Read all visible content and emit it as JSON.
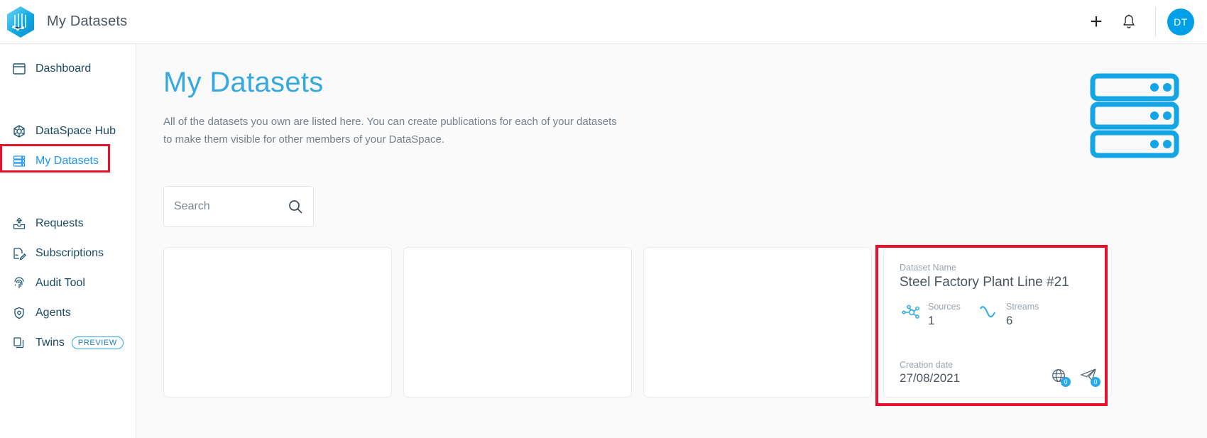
{
  "app": {
    "title": "My Datasets",
    "logo_icon": "hexagon-network-logo"
  },
  "topbar": {
    "add_icon": "plus-icon",
    "notifications_icon": "bell-icon",
    "avatar_initials": "DT"
  },
  "sidebar": {
    "items": [
      {
        "label": "Dashboard",
        "icon": "dashboard-icon",
        "active": false
      },
      {
        "label": "DataSpace Hub",
        "icon": "hub-icon",
        "active": false
      },
      {
        "label": "My Datasets",
        "icon": "database-icon",
        "active": true
      },
      {
        "label": "Requests",
        "icon": "inbox-upload-icon",
        "active": false
      },
      {
        "label": "Subscriptions",
        "icon": "signed-document-icon",
        "active": false
      },
      {
        "label": "Audit Tool",
        "icon": "fingerprint-icon",
        "active": false
      },
      {
        "label": "Agents",
        "icon": "shield-lock-icon",
        "active": false
      },
      {
        "label": "Twins",
        "icon": "copy-layers-icon",
        "active": false,
        "badge": "PREVIEW"
      }
    ]
  },
  "main": {
    "title": "My Datasets",
    "description": "All of the datasets you own are listed here. You can create publications for each of your datasets to make them visible for other members of your DataSpace.",
    "hero_icon": "server-stack-icon"
  },
  "search": {
    "placeholder": "Search",
    "value": "",
    "icon": "search-icon"
  },
  "cards": {
    "labels": {
      "dataset_name": "Dataset Name",
      "creation_date": "Creation date",
      "sources": "Sources",
      "streams": "Streams"
    },
    "empty_count": 3,
    "items": [
      {
        "name": "Steel Factory Plant Line #21",
        "sources": "1",
        "streams": "6",
        "creation_date": "27/08/2021",
        "sources_icon": "network-nodes-icon",
        "streams_icon": "wave-icon",
        "publish_icon": "globe-icon",
        "publish_count": "0",
        "share_icon": "paper-plane-icon",
        "share_count": "0"
      }
    ]
  },
  "colors": {
    "accent_blue": "#29a9e8",
    "title_blue": "#35a8e0",
    "annotation_red": "#e8112d",
    "avatar_blue": "#00a0e9"
  }
}
